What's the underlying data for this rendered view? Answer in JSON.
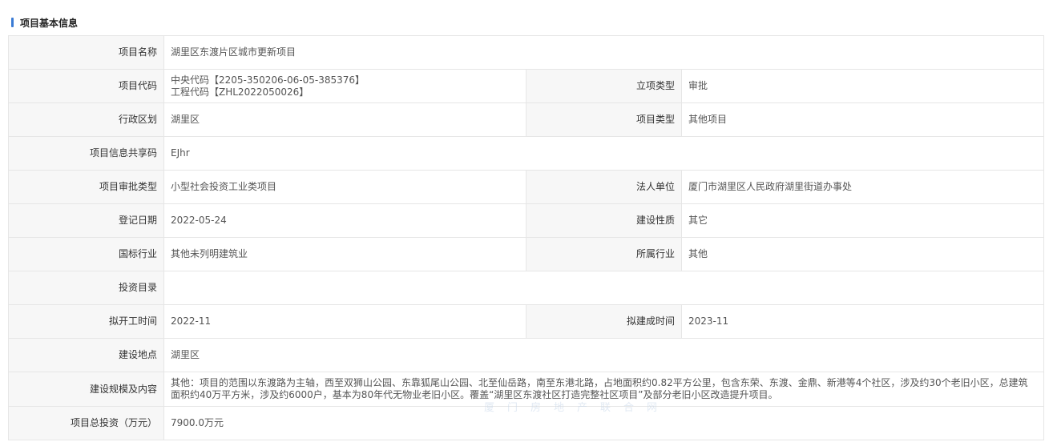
{
  "section": {
    "title": "项目基本信息"
  },
  "rows": {
    "project_name": {
      "label": "项目名称",
      "value": "湖里区东渡片区城市更新项目"
    },
    "project_code": {
      "label": "项目代码",
      "line1": "中央代码【2205-350206-06-05-385376】",
      "line2": "工程代码【ZHL2022050026】"
    },
    "approval_type": {
      "label": "立项类型",
      "value": "审批"
    },
    "district": {
      "label": "行政区划",
      "value": "湖里区"
    },
    "project_type": {
      "label": "项目类型",
      "value": "其他项目"
    },
    "share_code": {
      "label": "项目信息共享码",
      "value": "EJhr"
    },
    "review_category": {
      "label": "项目审批类型",
      "value": "小型社会投资工业类项目"
    },
    "legal_entity": {
      "label": "法人单位",
      "value": "厦门市湖里区人民政府湖里街道办事处"
    },
    "register_date": {
      "label": "登记日期",
      "value": "2022-05-24"
    },
    "construction_nature": {
      "label": "建设性质",
      "value": "其它"
    },
    "national_industry": {
      "label": "国标行业",
      "value": "其他未列明建筑业"
    },
    "industry": {
      "label": "所属行业",
      "value": "其他"
    },
    "investment_catalog": {
      "label": "投资目录",
      "value": ""
    },
    "planned_start": {
      "label": "拟开工时间",
      "value": "2022-11"
    },
    "planned_completion": {
      "label": "拟建成时间",
      "value": "2023-11"
    },
    "location": {
      "label": "建设地点",
      "value": "湖里区"
    },
    "scale": {
      "label": "建设规模及内容",
      "value": "其他：项目的范围以东渡路为主轴，西至双狮山公园、东靠狐尾山公园、北至仙岳路，南至东港北路，占地面积约0.82平方公里，包含东荣、东渡、金鼎、新港等4个社区，涉及约30个老旧小区，总建筑面积约40万平方米，涉及约6000户，基本为80年代无物业老旧小区。覆盖“湖里区东渡社区打造完整社区项目”及部分老旧小区改造提升项目。"
    },
    "total_investment": {
      "label": "项目总投资（万元）",
      "value": "7900.0万元"
    }
  },
  "watermark": "厦门房地产联合网"
}
